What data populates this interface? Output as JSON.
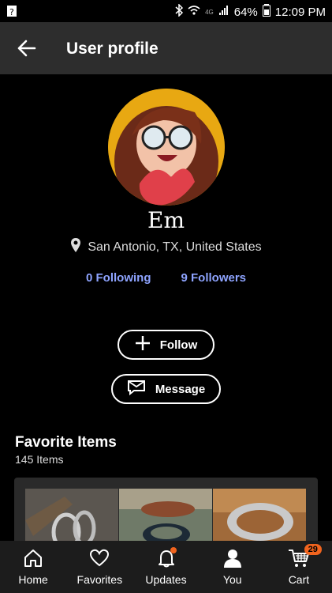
{
  "status_bar": {
    "network": "4G",
    "battery": "64%",
    "time": "12:09 PM"
  },
  "app_bar": {
    "title": "User profile"
  },
  "profile": {
    "name": "Em",
    "location": "San Antonio, TX, United States",
    "following": "0 Following",
    "followers": "9 Followers"
  },
  "actions": {
    "follow_label": "Follow",
    "message_label": "Message"
  },
  "favorites": {
    "title": "Favorite Items",
    "count": "145 Items"
  },
  "bottom_nav": {
    "items": [
      {
        "label": "Home",
        "icon": "home-icon"
      },
      {
        "label": "Favorites",
        "icon": "heart-icon"
      },
      {
        "label": "Updates",
        "icon": "bell-icon"
      },
      {
        "label": "You",
        "icon": "person-icon"
      },
      {
        "label": "Cart",
        "icon": "cart-icon"
      }
    ],
    "cart_badge": "29"
  },
  "colors": {
    "accent_link": "#8ea4ff",
    "badge": "#f1641e",
    "appbar": "#2d2d2d"
  }
}
